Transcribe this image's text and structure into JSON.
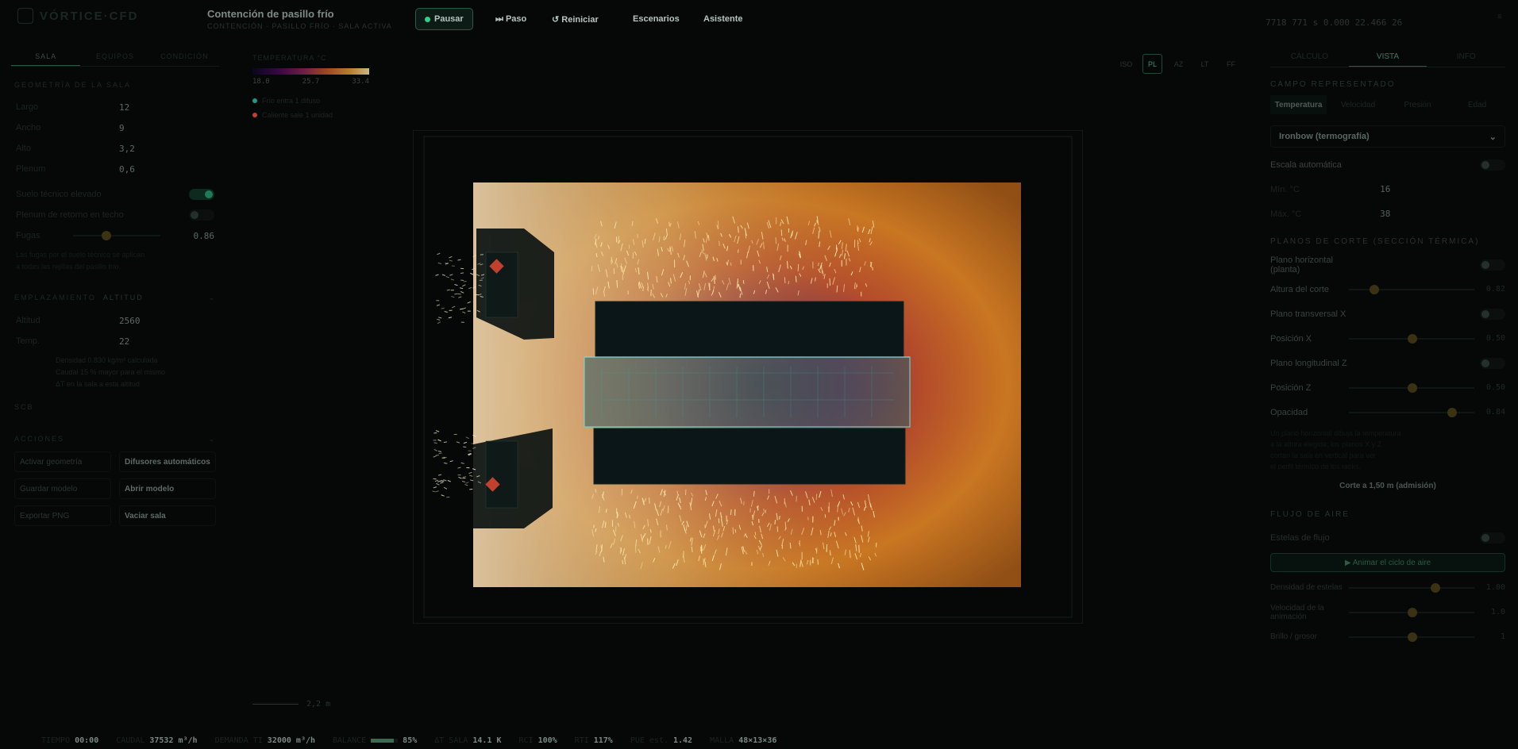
{
  "app": {
    "brand": "VÓRTICE·CFD",
    "project_title": "Contención de pasillo frío",
    "project_sub": "CONTENCIÓN · PASILLO FRÍO · SALA ACTIVA"
  },
  "toolbar": {
    "pause": "Pausar",
    "step": "⏭ Paso",
    "reset": "↺ Reiniciar",
    "scenarios": "Escenarios",
    "assistant": "Asistente",
    "stats": "7718  771 s  0.000  22.466  26"
  },
  "left": {
    "tabs": [
      "SALA",
      "EQUIPOS",
      "CONDICIÓN"
    ],
    "geometry_header": "GEOMETRÍA DE LA SALA",
    "dims": [
      {
        "label": "Largo",
        "value": "12"
      },
      {
        "label": "Ancho",
        "value": "9"
      },
      {
        "label": "Alto",
        "value": "3,2"
      },
      {
        "label": "Plenum",
        "value": "0,6"
      }
    ],
    "toggles": [
      {
        "label": "Suelo técnico elevado",
        "on": true
      },
      {
        "label": "Plenum de retorno en techo",
        "on": false
      }
    ],
    "slider": {
      "label": "Fugas",
      "value": "0.86",
      "level": 0.4
    },
    "notes": [
      "Las fugas por el suelo técnico se aplican",
      "a todas las rejillas del pasillo frío."
    ],
    "climate_header": "EMPLAZAMIENTO",
    "climate_tag": "ALTITUD",
    "climate": [
      {
        "label": "Altitud",
        "value": "2560"
      },
      {
        "label": "Temp.",
        "value": "22"
      }
    ],
    "climate_notes": [
      "Densidad 0.830 kg/m³ calculada",
      "Caudal 15 % mayor para el mismo",
      "ΔT en la sala a esta altitud"
    ],
    "climate_footer": "SCB",
    "actions_header": "ACCIONES",
    "actions": [
      {
        "label": "Activar geometría",
        "hi": false
      },
      {
        "label": "Difusores automáticos",
        "hi": true
      },
      {
        "label": "Guardar modelo",
        "hi": false
      },
      {
        "label": "Abrir modelo",
        "hi": true
      },
      {
        "label": "Exportar PNG",
        "hi": false
      },
      {
        "label": "Vaciar sala",
        "hi": true
      }
    ]
  },
  "center": {
    "legend_title": "TEMPERATURA °C",
    "ticks": [
      "18.0",
      "25.7",
      "33.4"
    ],
    "legend_items": [
      {
        "label": "Frío entra 1 difuso",
        "color": "#1f9a8a"
      },
      {
        "label": "Caliente sale 1 unidad",
        "color": "#c2402e"
      }
    ],
    "views": [
      "ISO",
      "PL",
      "AZ",
      "LT",
      "FF"
    ],
    "active_view": "PL",
    "scale": "2,2 m"
  },
  "right": {
    "tabs": [
      "CÁLCULO",
      "VISTA",
      "INFO"
    ],
    "active_tab": "VISTA",
    "field_header": "CAMPO REPRESENTADO",
    "fields": [
      "Temperatura",
      "Velocidad",
      "Presión",
      "Edad"
    ],
    "palette": "Ironbow (termografía)",
    "auto_scale": "Escala automática",
    "min": {
      "label": "Mín. °C",
      "value": "16"
    },
    "max": {
      "label": "Máx. °C",
      "value": "38"
    },
    "cuts_header": "PLANOS DE CORTE (SECCIÓN TÉRMICA)",
    "cuts": [
      {
        "label": "Plano horizontal (planta)",
        "kind": "toggle"
      },
      {
        "label": "Altura del corte",
        "kind": "slider",
        "value": "0.82",
        "level": 0.18
      },
      {
        "label": "Plano transversal X",
        "kind": "toggle"
      },
      {
        "label": "Posición X",
        "kind": "slider",
        "value": "0.50",
        "level": 0.5
      },
      {
        "label": "Plano longitudinal Z",
        "kind": "toggle"
      },
      {
        "label": "Posición Z",
        "kind": "slider",
        "value": "0.50",
        "level": 0.5
      },
      {
        "label": "Opacidad",
        "kind": "slider",
        "value": "0.84",
        "level": 0.84
      }
    ],
    "cut_note": [
      "Un plano horizontal dibuja la temperatura",
      "a la altura elegida; los planos X y Z",
      "cortan la sala en vertical para ver",
      "el perfil térmico de los racks."
    ],
    "cut_button": "Corte a 1,50 m (admisión)",
    "flow_header": "FLUJO DE AIRE",
    "flow_toggle": "Estelas de flujo",
    "anim_button": "▶ Animar el ciclo de aire",
    "flow_sliders": [
      {
        "label": "Densidad de estelas",
        "value": "1.00",
        "level": 0.7
      },
      {
        "label": "Velocidad de la animación",
        "value": "1.0",
        "level": 0.5
      },
      {
        "label": "Brillo / grosor",
        "value": "1",
        "level": 0.5
      }
    ]
  },
  "status": [
    {
      "k": "TIEMPO",
      "v": "00:00"
    },
    {
      "k": "CAUDAL",
      "v": "37532 m³/h"
    },
    {
      "k": "DEMANDA TI",
      "v": "32000 m³/h"
    },
    {
      "k": "BALANCE",
      "v": "85%",
      "bar": 0.85
    },
    {
      "k": "ΔT SALA",
      "v": "14.1 K"
    },
    {
      "k": "RCI",
      "v": "100%"
    },
    {
      "k": "RTI",
      "v": "117%"
    },
    {
      "k": "PUE est.",
      "v": "1.42"
    },
    {
      "k": "MALLA",
      "v": "48×13×36"
    }
  ]
}
